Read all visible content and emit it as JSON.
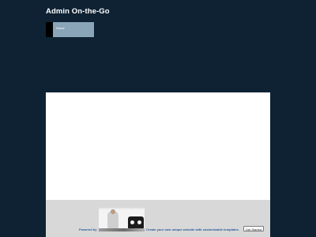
{
  "site": {
    "title": "Admin On-the-Go"
  },
  "nav": {
    "items": [
      {
        "label": "Home"
      }
    ]
  },
  "footer": {
    "powered_label": "Powered by",
    "ad_text": "Create your own unique website with customizable templates.",
    "cta_label": "Get Started"
  },
  "colors": {
    "background": "#0e2233",
    "nav_item": "#8aa5b8",
    "content": "#ffffff",
    "footer": "#d8d8d8",
    "link": "#2b5a9a"
  }
}
